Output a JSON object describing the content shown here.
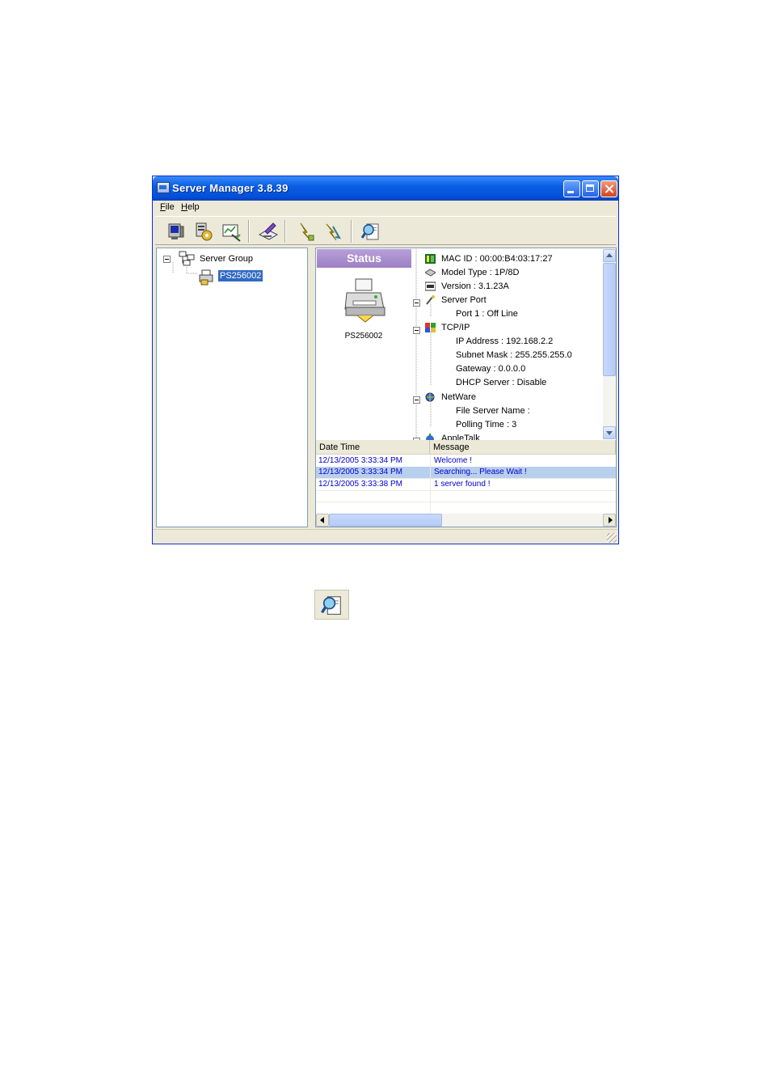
{
  "window": {
    "title": "Server Manager 3.8.39",
    "title_color": "#0a5ee6"
  },
  "menu": {
    "items": [
      "File",
      "Help"
    ]
  },
  "toolbar": {
    "tools": [
      "monitor-icon",
      "settings-icon",
      "report-icon",
      "edit-icon",
      "upgrade-icon",
      "reset-icon",
      "search-icon"
    ]
  },
  "tree": {
    "root": "Server Group",
    "child": "PS256002"
  },
  "status": {
    "header": "Status",
    "printer_name": "PS256002",
    "lines": [
      {
        "level": 0,
        "text": "MAC ID : 00:00:B4:03:17:27",
        "icon": "mac-icon"
      },
      {
        "level": 0,
        "text": "Model Type : 1P/8D",
        "icon": "model-icon"
      },
      {
        "level": 0,
        "text": "Version : 3.1.23A",
        "icon": "version-icon"
      },
      {
        "level": 0,
        "text": "Server Port",
        "icon": "port-icon"
      },
      {
        "level": 1,
        "text": "Port 1 : Off Line"
      },
      {
        "level": 0,
        "text": "TCP/IP",
        "icon": "tcpip-icon"
      },
      {
        "level": 1,
        "text": "IP Address : 192.168.2.2"
      },
      {
        "level": 1,
        "text": "Subnet Mask : 255.255.255.0"
      },
      {
        "level": 1,
        "text": "Gateway : 0.0.0.0"
      },
      {
        "level": 1,
        "text": "DHCP Server : Disable"
      },
      {
        "level": 0,
        "text": "NetWare",
        "icon": "netware-icon"
      },
      {
        "level": 1,
        "text": "File Server Name :"
      },
      {
        "level": 1,
        "text": "Polling Time : 3"
      },
      {
        "level": 0,
        "text": "AppleTalk",
        "icon": "appletalk-icon"
      }
    ]
  },
  "log": {
    "columns": [
      "Date Time",
      "Message"
    ],
    "rows": [
      {
        "time": "12/13/2005 3:33:34 PM",
        "message": "Welcome !"
      },
      {
        "time": "12/13/2005 3:33:34 PM",
        "message": "Searching... Please Wait !"
      },
      {
        "time": "12/13/2005 3:33:38 PM",
        "message": "1 server found !"
      }
    ],
    "text_color": "#0000cc",
    "selected_color": "#b8cfed"
  },
  "standalone_icon": "search-icon"
}
